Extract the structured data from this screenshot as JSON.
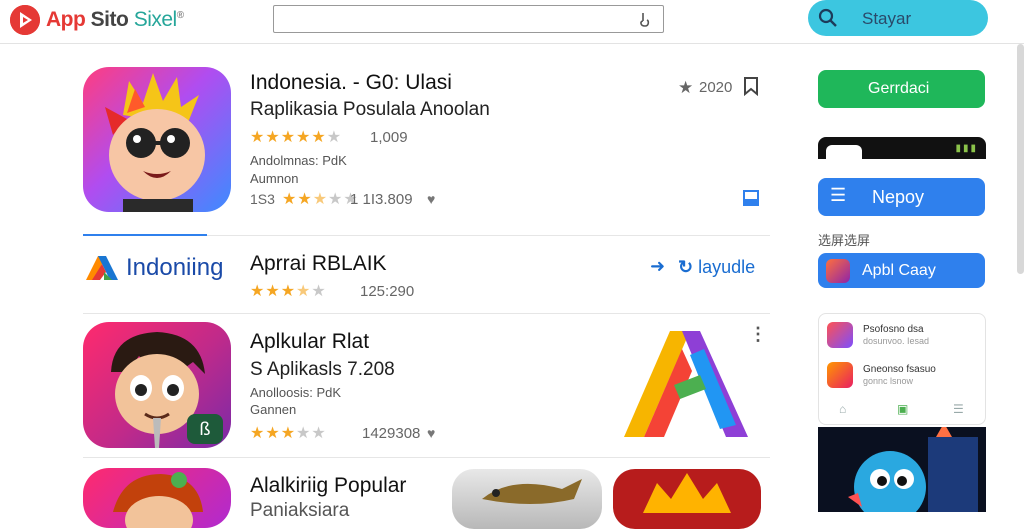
{
  "header": {
    "logo_text_a": "App",
    "logo_text_b": "Sito",
    "logo_text_c": "Sixel",
    "logo_mark": "®",
    "search_value": "",
    "search_placeholder": "",
    "pill_label": "Stayar"
  },
  "list": {
    "item1": {
      "title": "Indonesia. - G0: Ulasi",
      "subtitle": "Raplikasia Posulala Anoolan",
      "count": "1,009",
      "meta1": "Andolmnas: PdK",
      "meta2": "Aumnon",
      "count2": "1 1I3.809",
      "rank_prefix": "1S3",
      "top_rating": "2020",
      "rating": 4.5,
      "rating2": 2.5
    },
    "item2": {
      "brand": "Indoniing",
      "title": "Aprrai RBLAIK",
      "count": "125:290",
      "action_label": "layudle",
      "rating": 3.5
    },
    "item3": {
      "title": "Aplkular Rlat",
      "subtitle": "S Aplikasls  7.208",
      "meta1": "Anolloosis: PdK",
      "meta2": "Gannen",
      "count": "1429308",
      "badge": "ß",
      "rating": 3.0
    },
    "item4": {
      "title": "Alalkiriig Popular",
      "subtitle": "Paniaksiara"
    }
  },
  "sidebar": {
    "green_button": "Gerrdaci",
    "blue_button": "Nepoy",
    "section_label": "选屏选屏",
    "app_button": "Apbl Caay",
    "mini_rows": [
      {
        "t1": "Psofosno dsa",
        "t2": "dosunvoo. Iesad"
      },
      {
        "t1": "Gneonso fsasuo",
        "t2": "gonnc lsnow"
      }
    ]
  },
  "colors": {
    "accent_green": "#1fb75a",
    "accent_blue": "#2f80ed",
    "pill": "#3cc6e0",
    "star": "#f5a623",
    "logo_red": "#e53935"
  },
  "icons": [
    "logo-icon",
    "mic-icon",
    "search-icon",
    "star-icon",
    "bookmark-icon",
    "heart-icon",
    "arrow-icon",
    "more-icon",
    "menu-icon"
  ]
}
